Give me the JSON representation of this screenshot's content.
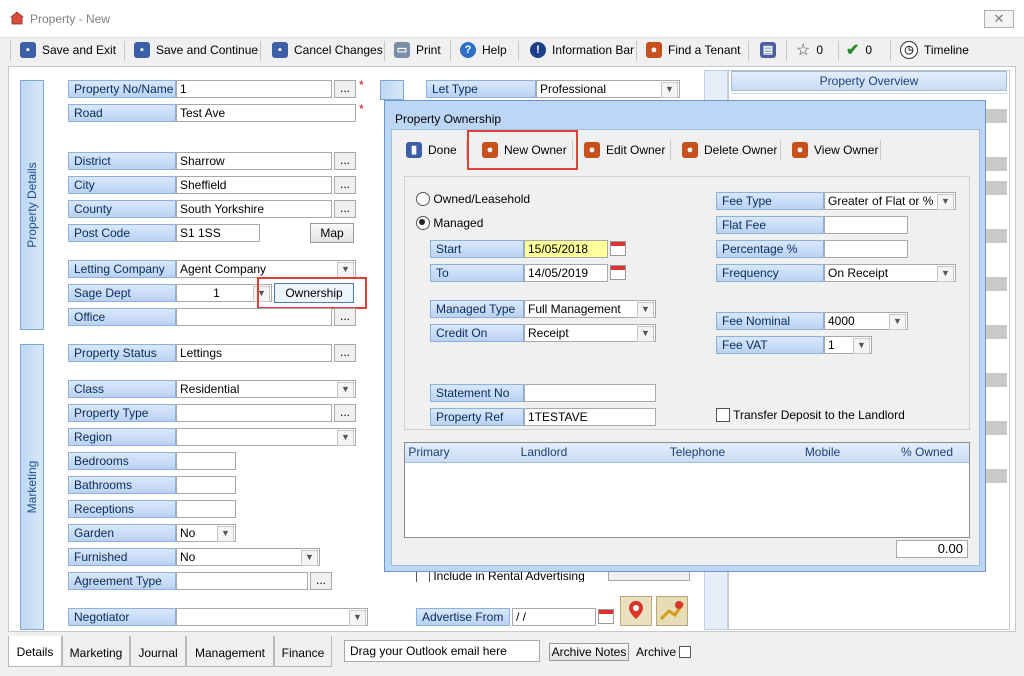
{
  "window": {
    "title": "Property  - New",
    "close": "✕"
  },
  "toolbar": {
    "save_exit": "Save and Exit",
    "save_continue": "Save and Continue",
    "cancel": "Cancel Changes",
    "print": "Print",
    "help": "Help",
    "info_bar": "Information Bar",
    "find_tenant": "Find a Tenant",
    "star_count": "0",
    "check_count": "0",
    "timeline": "Timeline"
  },
  "property_details": {
    "tab_label": "Property Details",
    "fields": {
      "property_no": {
        "label": "Property No/Name",
        "value": "1"
      },
      "road": {
        "label": "Road",
        "value": "Test Ave"
      },
      "district": {
        "label": "District",
        "value": "Sharrow"
      },
      "city": {
        "label": "City",
        "value": "Sheffield"
      },
      "county": {
        "label": "County",
        "value": "South Yorkshire"
      },
      "post_code": {
        "label": "Post Code",
        "value": "S1 1SS"
      },
      "letting_company": {
        "label": "Letting Company",
        "value": "Agent Company"
      },
      "sage_dept": {
        "label": "Sage Dept",
        "value": "1"
      },
      "office": {
        "label": "Office",
        "value": ""
      }
    },
    "map_button": "Map",
    "ownership_button": "Ownership",
    "ellipsis": "...",
    "required": "*"
  },
  "marketing": {
    "tab_label": "Marketing",
    "fields": {
      "property_status": {
        "label": "Property Status",
        "value": "Lettings"
      },
      "class": {
        "label": "Class",
        "value": "Residential"
      },
      "property_type": {
        "label": "Property Type",
        "value": ""
      },
      "region": {
        "label": "Region",
        "value": ""
      },
      "bedrooms": {
        "label": "Bedrooms",
        "value": ""
      },
      "bathrooms": {
        "label": "Bathrooms",
        "value": ""
      },
      "receptions": {
        "label": "Receptions",
        "value": ""
      },
      "garden": {
        "label": "Garden",
        "value": "No"
      },
      "furnished": {
        "label": "Furnished",
        "value": "No"
      },
      "agreement_type": {
        "label": "Agreement Type",
        "value": ""
      },
      "negotiator": {
        "label": "Negotiator",
        "value": ""
      }
    }
  },
  "middle": {
    "let_type": {
      "label": "Let Type",
      "value": "Professional"
    },
    "include_advertising": "Include in Rental Advertising",
    "advertise_from": {
      "label": "Advertise From",
      "value": " / /"
    }
  },
  "overview": {
    "title": "Property Overview"
  },
  "dialog": {
    "title": "Property Ownership",
    "toolbar": {
      "done": "Done",
      "new_owner": "New Owner",
      "edit_owner": "Edit Owner",
      "delete_owner": "Delete Owner",
      "view_owner": "View Owner"
    },
    "owned_leasehold": "Owned/Leasehold",
    "managed": "Managed",
    "selected_option": "Managed",
    "start": {
      "label": "Start",
      "value": "15/05/2018"
    },
    "to": {
      "label": "To",
      "value": "14/05/2019"
    },
    "managed_type": {
      "label": "Managed Type",
      "value": "Full Management"
    },
    "credit_on": {
      "label": "Credit On",
      "value": "Receipt"
    },
    "statement_no": {
      "label": "Statement No",
      "value": ""
    },
    "property_ref": {
      "label": "Property Ref",
      "value": "1TESTAVE"
    },
    "fee_type": {
      "label": "Fee Type",
      "value": "Greater of Flat or %"
    },
    "flat_fee": {
      "label": "Flat Fee",
      "value": ""
    },
    "percentage": {
      "label": "Percentage %",
      "value": ""
    },
    "frequency": {
      "label": "Frequency",
      "value": "On Receipt"
    },
    "fee_nominal": {
      "label": "Fee Nominal",
      "value": "4000"
    },
    "fee_vat": {
      "label": "Fee VAT",
      "value": "1"
    },
    "transfer_deposit": "Transfer Deposit to the Landlord",
    "grid_columns": [
      "Primary",
      "Landlord",
      "Telephone",
      "Mobile",
      "% Owned"
    ],
    "grid_rows": [],
    "total": "0.00"
  },
  "bottom": {
    "tabs": [
      "Details",
      "Marketing",
      "Journal",
      "Management",
      "Finance"
    ],
    "active_tab": "Details",
    "outlook_drop": "Drag your Outlook email here",
    "archive_notes": "Archive Notes",
    "archive": "Archive"
  },
  "colors": {
    "highlight_red": "#e0403a",
    "label_blue": "#b9d2f3",
    "date_yellow": "#ffff99"
  }
}
